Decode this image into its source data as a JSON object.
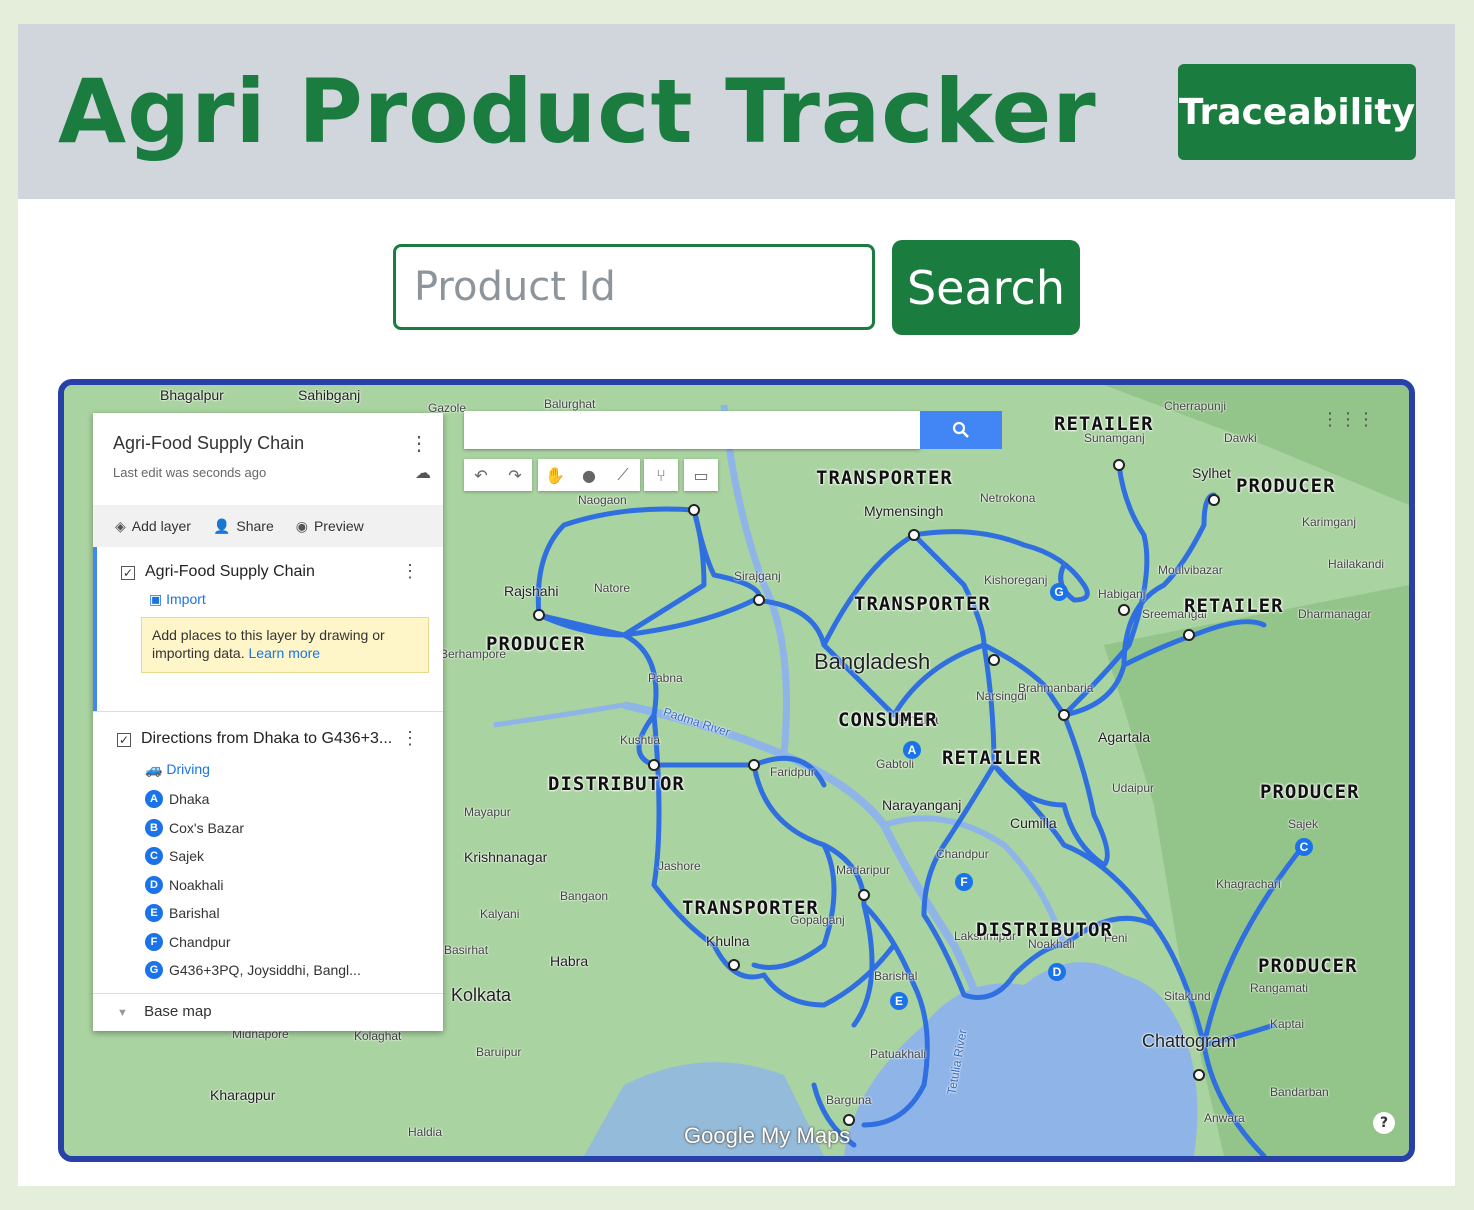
{
  "header": {
    "title": "Agri Product Tracker",
    "traceability_label": "Traceability"
  },
  "search": {
    "placeholder": "Product Id",
    "button_label": "Search"
  },
  "map": {
    "panel": {
      "title": "Agri-Food Supply Chain",
      "subtitle": "Last edit was seconds ago",
      "actions": {
        "add_layer": "Add layer",
        "share": "Share",
        "preview": "Preview"
      },
      "layer1": {
        "name": "Agri-Food Supply Chain",
        "import_label": "Import",
        "tip_text": "Add places to this layer by drawing or importing data.",
        "tip_link": "Learn more"
      },
      "layer2": {
        "name": "Directions from Dhaka to G436+3...",
        "mode": "Driving",
        "stops": [
          {
            "letter": "A",
            "name": "Dhaka"
          },
          {
            "letter": "B",
            "name": "Cox's Bazar"
          },
          {
            "letter": "C",
            "name": "Sajek"
          },
          {
            "letter": "D",
            "name": "Noakhali"
          },
          {
            "letter": "E",
            "name": "Barishal"
          },
          {
            "letter": "F",
            "name": "Chandpur"
          },
          {
            "letter": "G",
            "name": "G436+3PQ, Joysiddhi, Bangl..."
          }
        ]
      },
      "basemap_label": "Base map"
    },
    "roles": {
      "retailer_top": "RETAILER",
      "transporter_top": "TRANSPORTER",
      "producer_sylhet": "PRODUCER",
      "transporter_mid": "TRANSPORTER",
      "retailer_right": "RETAILER",
      "producer_rajshahi": "PRODUCER",
      "consumer": "CONSUMER",
      "retailer_dhaka": "RETAILER",
      "distributor_west": "DISTRIBUTOR",
      "producer_east": "PRODUCER",
      "transporter_khulna": "TRANSPORTER",
      "distributor_south": "DISTRIBUTOR",
      "producer_south": "PRODUCER"
    },
    "places": {
      "bangladesh": "Bangladesh",
      "rajshahi": "Rajshahi",
      "mymensingh": "Mymensingh",
      "sylhet": "Sylhet",
      "dhaka": "Dhaka",
      "kolkata": "Kolkata",
      "khulna": "Khulna",
      "chattogram": "Chattogram",
      "agartala": "Agartala",
      "cumilla": "Cumilla",
      "narayanganj": "Narayanganj",
      "barishal": "Barishal",
      "pabna": "Pabna",
      "kushtia": "Kushtia",
      "jashore": "Jashore",
      "barguna": "Barguna",
      "krishnanagar": "Krishnanagar",
      "khagrachari": "Khagrachari",
      "sajek": "Sajek",
      "kaptai": "Kaptai",
      "rangamati": "Rangamati",
      "bhagalpur": "Bhagalpur",
      "sahibganj": "Sahibganj",
      "kharagpur": "Kharagpur",
      "midnapore": "Midnapore",
      "habra": "Habra",
      "cherrapunji": "Cherrapunji",
      "sunamganj": "Sunamganj",
      "netrokona": "Netrokona",
      "faridpur": "Faridpur",
      "madaripur": "Madaripur",
      "patuakhali": "Patuakhali",
      "chandpur": "Chandpur",
      "noakhali": "Noakhali",
      "lakshmipur": "Lakshmipur",
      "naogaon": "Naogaon",
      "sirajganj": "Sirajganj",
      "natore": "Natore",
      "gopalganj": "Gopalganj",
      "padma_river": "Padma River",
      "tetulia_river": "Tetulia River",
      "balurghat": "Balurghat",
      "gazole": "Gazole",
      "dawki": "Dawki",
      "karimganj": "Karimganj",
      "hailakandi": "Hailakandi",
      "habiganj": "Habiganj",
      "moulvibazar": "Moulvibazar",
      "sreemangal": "Sreemangal",
      "dharmanagar": "Dharmanagar",
      "udaipur": "Udaipur",
      "bandarban": "Bandarban",
      "anwara": "Anwara",
      "sitakund": "Sitakund",
      "feni": "Feni",
      "narsingdi": "Narsingdi",
      "brahmanbaria": "Brahmanbaria",
      "kishoreganj": "Kishoreganj",
      "gabtoli": "Gabtoli",
      "kalyani": "Kalyani",
      "bangaon": "Bangaon",
      "basirhat": "Basirhat",
      "baruipur": "Baruipur",
      "haldia": "Haldia",
      "kolaghat": "Kolaghat",
      "mayapur": "Mayapur",
      "berhampore": "Berhampore"
    },
    "attribution": "Google My Maps",
    "help_label": "?",
    "colors": {
      "route": "#2f6fe0",
      "land": "#a9d3a0",
      "water": "#8fb5e8",
      "frame": "#2741a8",
      "brand_green": "#1a7c3e"
    }
  }
}
